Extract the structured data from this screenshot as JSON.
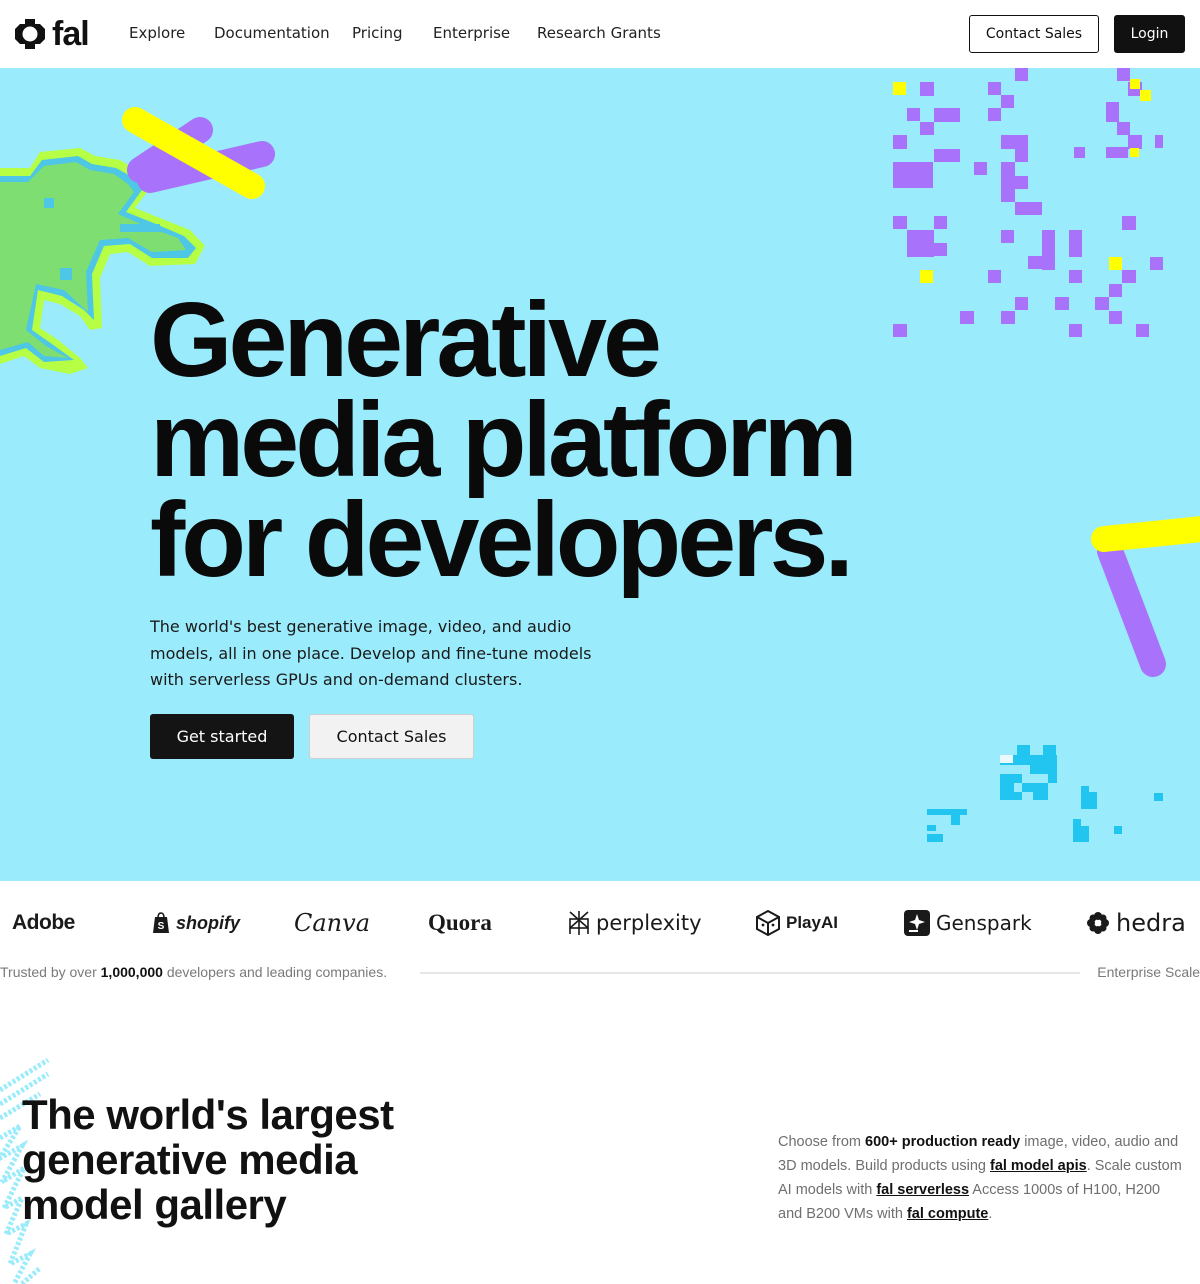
{
  "nav": {
    "logo_text": "fal",
    "links": [
      "Explore",
      "Documentation",
      "Pricing",
      "Enterprise",
      "Research Grants"
    ],
    "contact_label": "Contact Sales",
    "login_label": "Login"
  },
  "hero": {
    "title_lines": [
      "Generative",
      "media platform",
      "for developers."
    ],
    "subtitle": "The world's best generative image, video, and audio models, all in one place. Develop and fine-tune models with serverless GPUs and on-demand clusters.",
    "primary_cta": "Get started",
    "secondary_cta": "Contact Sales"
  },
  "brands": [
    "Adobe",
    "shopify",
    "Canva",
    "Quora",
    "perplexity",
    "PlayAI",
    "Genspark",
    "hedra"
  ],
  "trust": {
    "prefix": "Trusted by over",
    "count": "1,000,000",
    "suffix": "developers and leading companies.",
    "right_label": "Enterprise Scale"
  },
  "gallery": {
    "title_lines": [
      "The world's largest",
      "generative media",
      "model gallery"
    ],
    "desc_1": "Choose from",
    "desc_bold": "600+ production ready",
    "desc_2": "image, video, audio and 3D models. Build products using",
    "link_1": "fal model apis",
    "desc_3": ". Scale custom AI models with",
    "link_2": "fal serverless",
    "desc_4": "Access 1000s of H100, H200 and B200 VMs with",
    "link_3": "fal compute",
    "desc_5": "."
  },
  "colors": {
    "hero_bg": "#9aebfb",
    "accent_yellow": "#ffff00",
    "accent_purple": "#a972fa",
    "accent_green": "#b6ff45"
  }
}
